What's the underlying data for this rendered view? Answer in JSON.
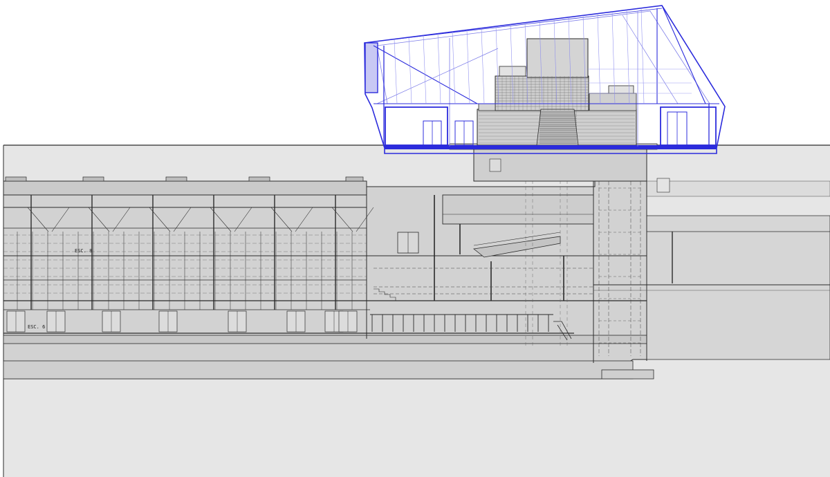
{
  "drawing": {
    "labels": {
      "escalator_upper": "ESC. 8",
      "escalator_lower": "ESC. 6"
    }
  },
  "colors": {
    "background": "#ffffff",
    "ground_fill": "#e6e6e6",
    "structure_fill": "#d2d2d2",
    "dark_fill": "#bdbdbd",
    "linework": "#2a2a2a",
    "pavilion_blue": "#2b2bdc",
    "pavilion_blue_light": "#7a7ae8"
  },
  "icons": {
    "pavilion": "glass-pavilion-roof-structure",
    "core": "central-tower-core",
    "station": "underground-station-hall"
  }
}
